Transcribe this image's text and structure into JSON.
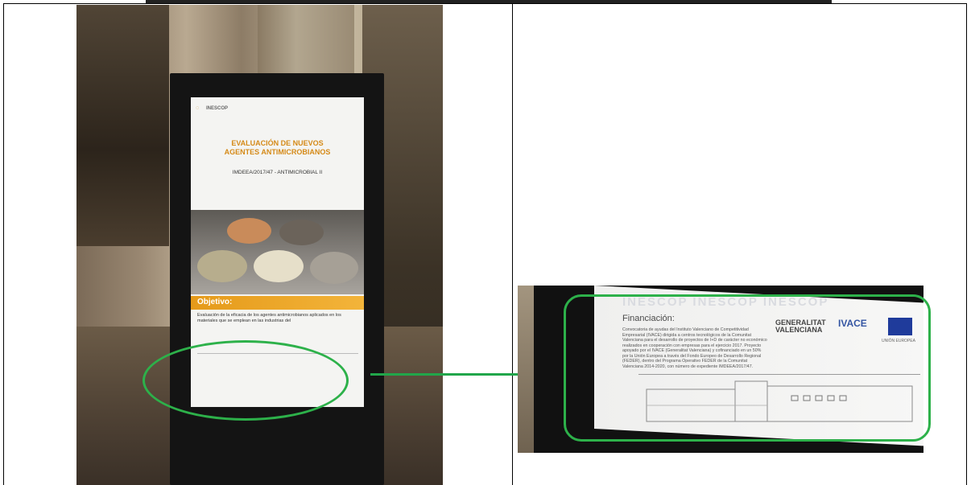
{
  "poster": {
    "logo": "INESCOP",
    "title_line1": "EVALUACIÓN DE NUEVOS",
    "title_line2": "AGENTES ANTIMICROBIANOS",
    "code": "IMDEEA/2017/47 - ANTIMICROBIAL II",
    "objective_heading": "Objetivo:",
    "objective_text": "Evaluación de la eficacia de los agentes antimicrobianos aplicados en los materiales que se emplean en las industrias del"
  },
  "closeup": {
    "watermark": "INESCOP   INESCOP   INESCOP",
    "financing_heading": "Financiación:",
    "financing_text": "Convocatoria de ayudas del Instituto Valenciano de Competitividad Empresarial (IVACE) dirigida a centros tecnológicos de la Comunitat Valenciana para el desarrollo de proyectos de I+D de carácter no económico realizados en cooperación con empresas para el ejercicio 2017. Proyecto apoyado por el IVACE (Generalitat Valenciana) y cofinanciado en un 50% por la Unión Europea a través del Fondo Europeo de Desarrollo Regional (FEDER), dentro del Programa Operativo FEDER de la Comunitat Valenciana 2014-2020, con número de expediente IMDEEA/2017/47.",
    "gv_line1": "GENERALITAT",
    "gv_line2": "VALENCIANA",
    "ivace_logo": "IVACE",
    "eu_label": "UNIÓN EUROPEA"
  },
  "colors": {
    "highlight_green": "#2db14a",
    "poster_orange": "#e59a1a"
  }
}
